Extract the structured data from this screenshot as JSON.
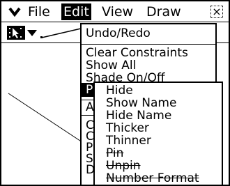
{
  "menubar": {
    "items": [
      "File",
      "Edit",
      "View",
      "Draw"
    ],
    "close_symbol": "×",
    "menu_icon": "chevron-down-icon"
  },
  "toolbar": {
    "tools": [
      "select-arrow-icon",
      "dropdown-triangle-icon",
      "line-tool-icon"
    ]
  },
  "edit_menu": {
    "items": [
      "Undo/Redo",
      "Clear Constraints",
      "Show All",
      "Shade On/Off",
      "P",
      "A",
      "C",
      "C",
      "P",
      "S",
      "D"
    ],
    "selected_index": 4
  },
  "sub_menu": {
    "items": [
      "Hide",
      "Show Name",
      "Hide Name",
      "Thicker",
      "Thinner",
      "Pin",
      "Unpin",
      "Number Format"
    ],
    "disabled": [
      "Pin",
      "Unpin",
      "Number Format"
    ]
  }
}
